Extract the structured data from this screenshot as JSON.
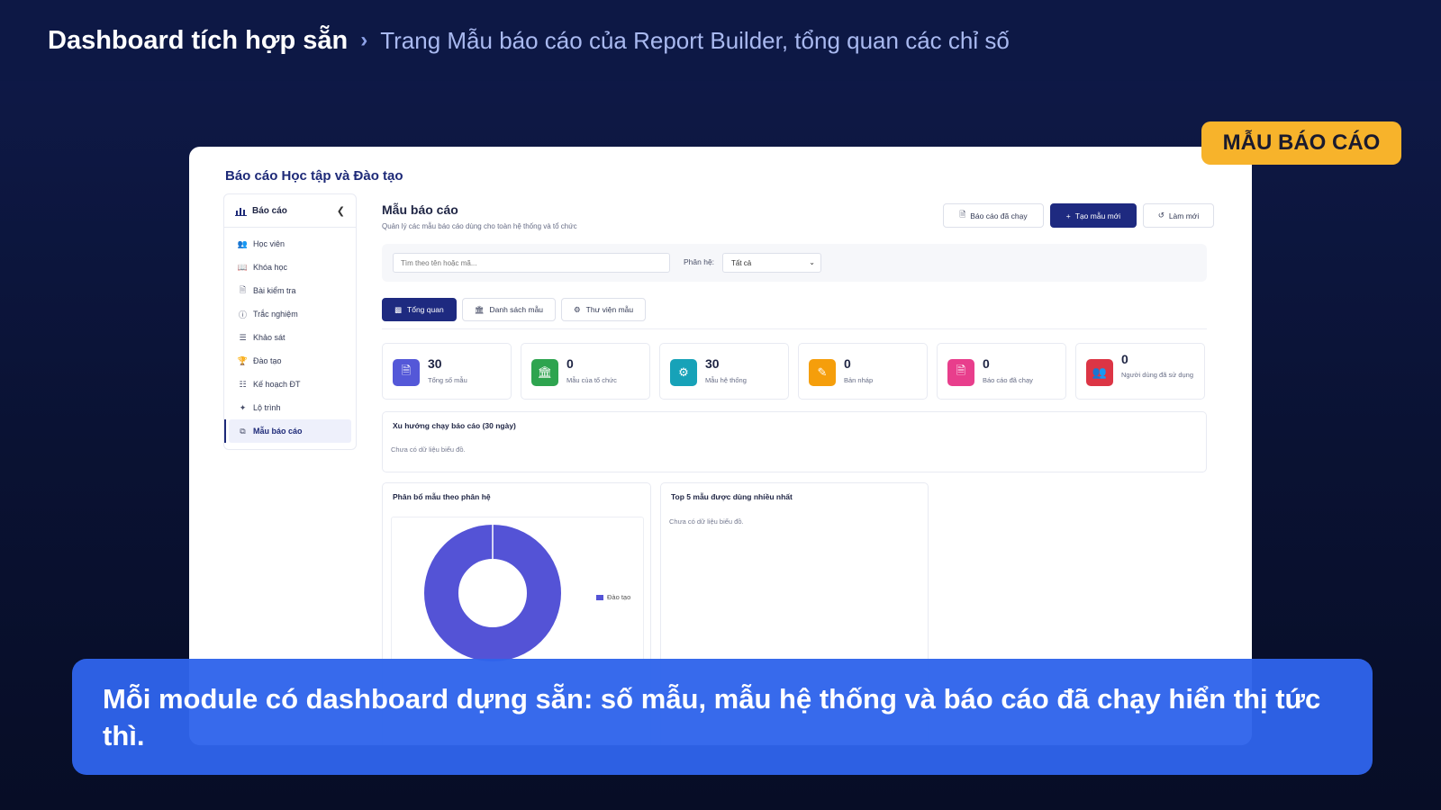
{
  "header": {
    "title": "Dashboard tích hợp sẵn",
    "separator": "›",
    "subtitle": "Trang Mẫu báo cáo của Report Builder, tổng quan các chỉ số"
  },
  "badge": "MẪU BÁO CÁO",
  "card": {
    "title": "Báo cáo Học tập và Đào tạo"
  },
  "sidebar": {
    "header": "Báo cáo",
    "items": [
      {
        "label": "Học viên",
        "icon": "users-icon"
      },
      {
        "label": "Khóa học",
        "icon": "book-icon"
      },
      {
        "label": "Bài kiểm tra",
        "icon": "file-icon"
      },
      {
        "label": "Trắc nghiệm",
        "icon": "question-icon"
      },
      {
        "label": "Khảo sát",
        "icon": "list-icon"
      },
      {
        "label": "Đào tạo",
        "icon": "trophy-icon"
      },
      {
        "label": "Kế hoạch ĐT",
        "icon": "plan-icon"
      },
      {
        "label": "Lộ trình",
        "icon": "route-icon"
      },
      {
        "label": "Mẫu báo cáo",
        "icon": "template-icon"
      }
    ]
  },
  "main": {
    "title": "Mẫu báo cáo",
    "subtitle": "Quản lý các mẫu báo cáo dùng cho toàn hệ thống và tổ chức",
    "buttons": {
      "runs": "Báo cáo đã chạy",
      "create": "Tạo mẫu mới",
      "refresh": "Làm mới"
    },
    "search_placeholder": "Tìm theo tên hoặc mã...",
    "filter_label": "Phân hệ:",
    "filter_value": "Tất cả",
    "tabs": [
      "Tổng quan",
      "Danh sách mẫu",
      "Thư viện mẫu"
    ],
    "stats": [
      {
        "value": "30",
        "label": "Tổng số mẫu",
        "color": "#5458d8"
      },
      {
        "value": "0",
        "label": "Mẫu của tổ chức",
        "color": "#2ea44f"
      },
      {
        "value": "30",
        "label": "Mẫu hệ thống",
        "color": "#17a2b8"
      },
      {
        "value": "0",
        "label": "Bản nháp",
        "color": "#f59e0b"
      },
      {
        "value": "0",
        "label": "Báo cáo đã chạy",
        "color": "#e83e8c"
      },
      {
        "value": "0",
        "label": "Người dùng đã sử dụng",
        "color": "#dc3545"
      }
    ],
    "trend": {
      "title": "Xu hướng chạy báo cáo (30 ngày)",
      "empty": "Chưa có dữ liệu biểu đồ."
    },
    "distribution": {
      "title": "Phân bổ mẫu theo phân hệ",
      "legend": "Đào tạo",
      "color": "#5453d6"
    },
    "top5": {
      "title": "Top 5 mẫu được dùng nhiều nhất",
      "empty": "Chưa có dữ liệu biểu đồ."
    }
  },
  "caption": "Mỗi module có dashboard dựng sẵn: số mẫu, mẫu hệ thống và báo cáo đã chạy hiển thị tức thì."
}
